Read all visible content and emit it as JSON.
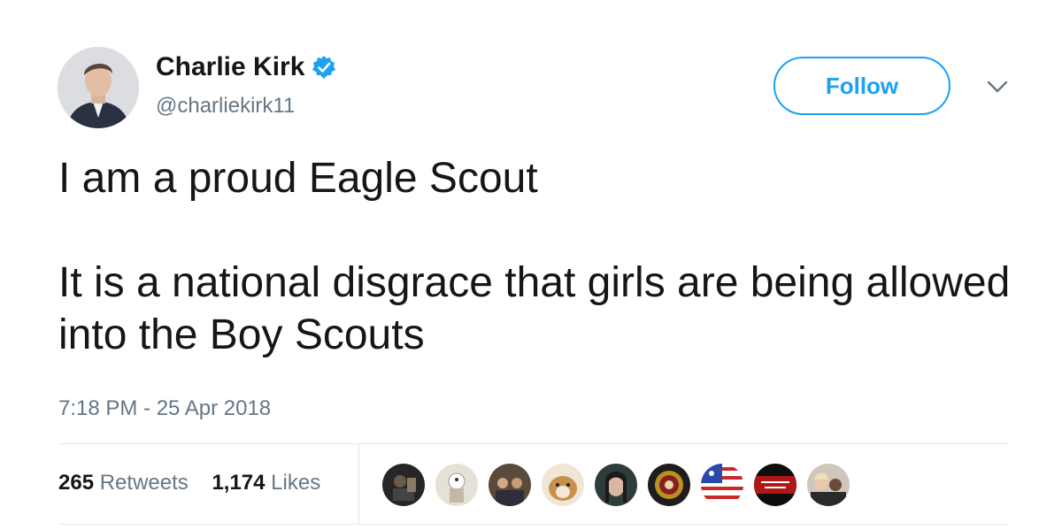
{
  "user": {
    "display_name": "Charlie Kirk",
    "handle": "@charliekirk11",
    "verified": true
  },
  "follow_button": {
    "label": "Follow"
  },
  "tweet": {
    "paragraphs": [
      "I am a proud Eagle Scout",
      "It is a national disgrace that girls are being allowed into the Boy Scouts"
    ],
    "timestamp": "7:18 PM - 25 Apr 2018"
  },
  "stats": {
    "retweets_count": "265",
    "retweets_label": "Retweets",
    "likes_count": "1,174",
    "likes_label": "Likes"
  },
  "likers": [
    {
      "icon": "liker-avatar-1",
      "color": "#2b2b2b"
    },
    {
      "icon": "liker-avatar-2",
      "color": "#d8d2c4"
    },
    {
      "icon": "liker-avatar-3",
      "color": "#6b5a4a"
    },
    {
      "icon": "liker-avatar-4",
      "color": "#c99a5e"
    },
    {
      "icon": "liker-avatar-5",
      "color": "#3a4a4a"
    },
    {
      "icon": "liker-avatar-6",
      "color": "#222222"
    },
    {
      "icon": "liker-avatar-7",
      "color": "#2a4aa8"
    },
    {
      "icon": "liker-avatar-8",
      "color": "#1a1a1a"
    },
    {
      "icon": "liker-avatar-9",
      "color": "#9a8a7a"
    }
  ],
  "colors": {
    "accent": "#1da1f2",
    "text": "#14171a",
    "secondary": "#657786",
    "divider": "#e1e8ed"
  }
}
